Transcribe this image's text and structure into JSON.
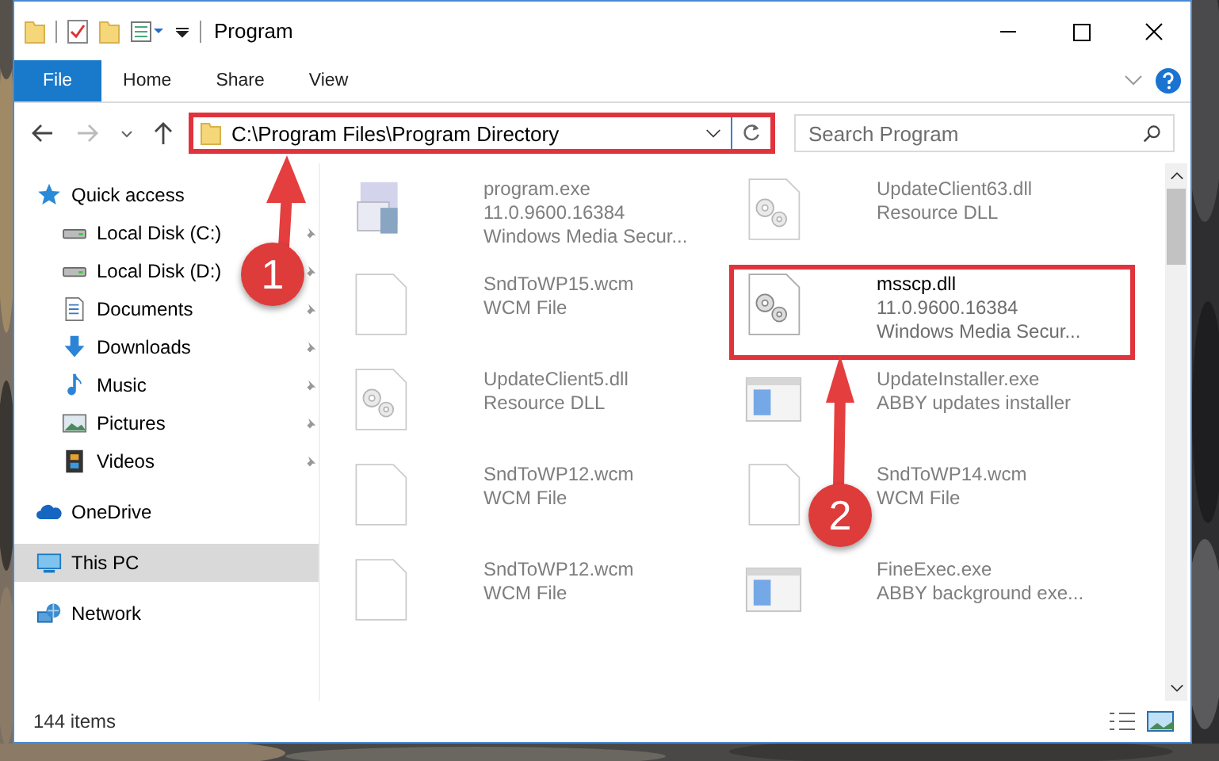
{
  "window": {
    "title": "Program"
  },
  "ribbon_tabs": [
    {
      "label": "File",
      "selected": true
    },
    {
      "label": "Home",
      "selected": false
    },
    {
      "label": "Share",
      "selected": false
    },
    {
      "label": "View",
      "selected": false
    }
  ],
  "address": {
    "path": "C:\\Program Files\\Program Directory",
    "highlighted": true
  },
  "search": {
    "placeholder": "Search Program"
  },
  "sidebar": {
    "items": [
      {
        "label": "Quick access",
        "kind": "star",
        "selected": false,
        "children": [
          {
            "label": "Local Disk (C:)",
            "kind": "disk",
            "pinned": true,
            "selected": false
          },
          {
            "label": "Local Disk (D:)",
            "kind": "disk",
            "pinned": true,
            "selected": false
          },
          {
            "label": "Documents",
            "kind": "document",
            "pinned": true,
            "selected": false
          },
          {
            "label": "Downloads",
            "kind": "download",
            "pinned": true,
            "selected": false
          },
          {
            "label": "Music",
            "kind": "music",
            "pinned": true,
            "selected": false
          },
          {
            "label": "Pictures",
            "kind": "pictures",
            "pinned": true,
            "selected": false
          },
          {
            "label": "Videos",
            "kind": "videos",
            "pinned": true,
            "selected": false
          }
        ]
      },
      {
        "label": "OneDrive",
        "kind": "cloud",
        "selected": false
      },
      {
        "label": "This PC",
        "kind": "pc",
        "selected": true
      },
      {
        "label": "Network",
        "kind": "network",
        "selected": false
      }
    ]
  },
  "files": [
    {
      "name": "program.exe",
      "details": [
        "11.0.9600.16384",
        "Windows Media Secur..."
      ],
      "kind": "exe",
      "blurred": true,
      "highlighted": false
    },
    {
      "name": "UpdateClient63.dll",
      "details": [
        "Resource DLL"
      ],
      "kind": "dll",
      "blurred": true,
      "highlighted": false
    },
    {
      "name": "SndToWP15.wcm",
      "details": [
        "WCM File"
      ],
      "kind": "file",
      "blurred": true,
      "highlighted": false
    },
    {
      "name": "msscp.dll",
      "details": [
        "11.0.9600.16384",
        "Windows Media Secur..."
      ],
      "kind": "dll",
      "blurred": false,
      "highlighted": true
    },
    {
      "name": "UpdateClient5.dll",
      "details": [
        "Resource DLL"
      ],
      "kind": "dll",
      "blurred": true,
      "highlighted": false
    },
    {
      "name": "UpdateInstaller.exe",
      "details": [
        "ABBY updates installer"
      ],
      "kind": "app",
      "blurred": true,
      "highlighted": false
    },
    {
      "name": "SndToWP12.wcm",
      "details": [
        "WCM File"
      ],
      "kind": "file",
      "blurred": true,
      "highlighted": false
    },
    {
      "name": "SndToWP14.wcm",
      "details": [
        "WCM File"
      ],
      "kind": "file",
      "blurred": true,
      "highlighted": false
    },
    {
      "name": "SndToWP12.wcm",
      "details": [
        "WCM File"
      ],
      "kind": "file",
      "blurred": true,
      "highlighted": false
    },
    {
      "name": "FineExec.exe",
      "details": [
        "ABBY background exe..."
      ],
      "kind": "app",
      "blurred": true,
      "highlighted": false
    }
  ],
  "status_bar": {
    "count": "144 items"
  },
  "annotations": [
    {
      "number": "1"
    },
    {
      "number": "2"
    }
  ]
}
